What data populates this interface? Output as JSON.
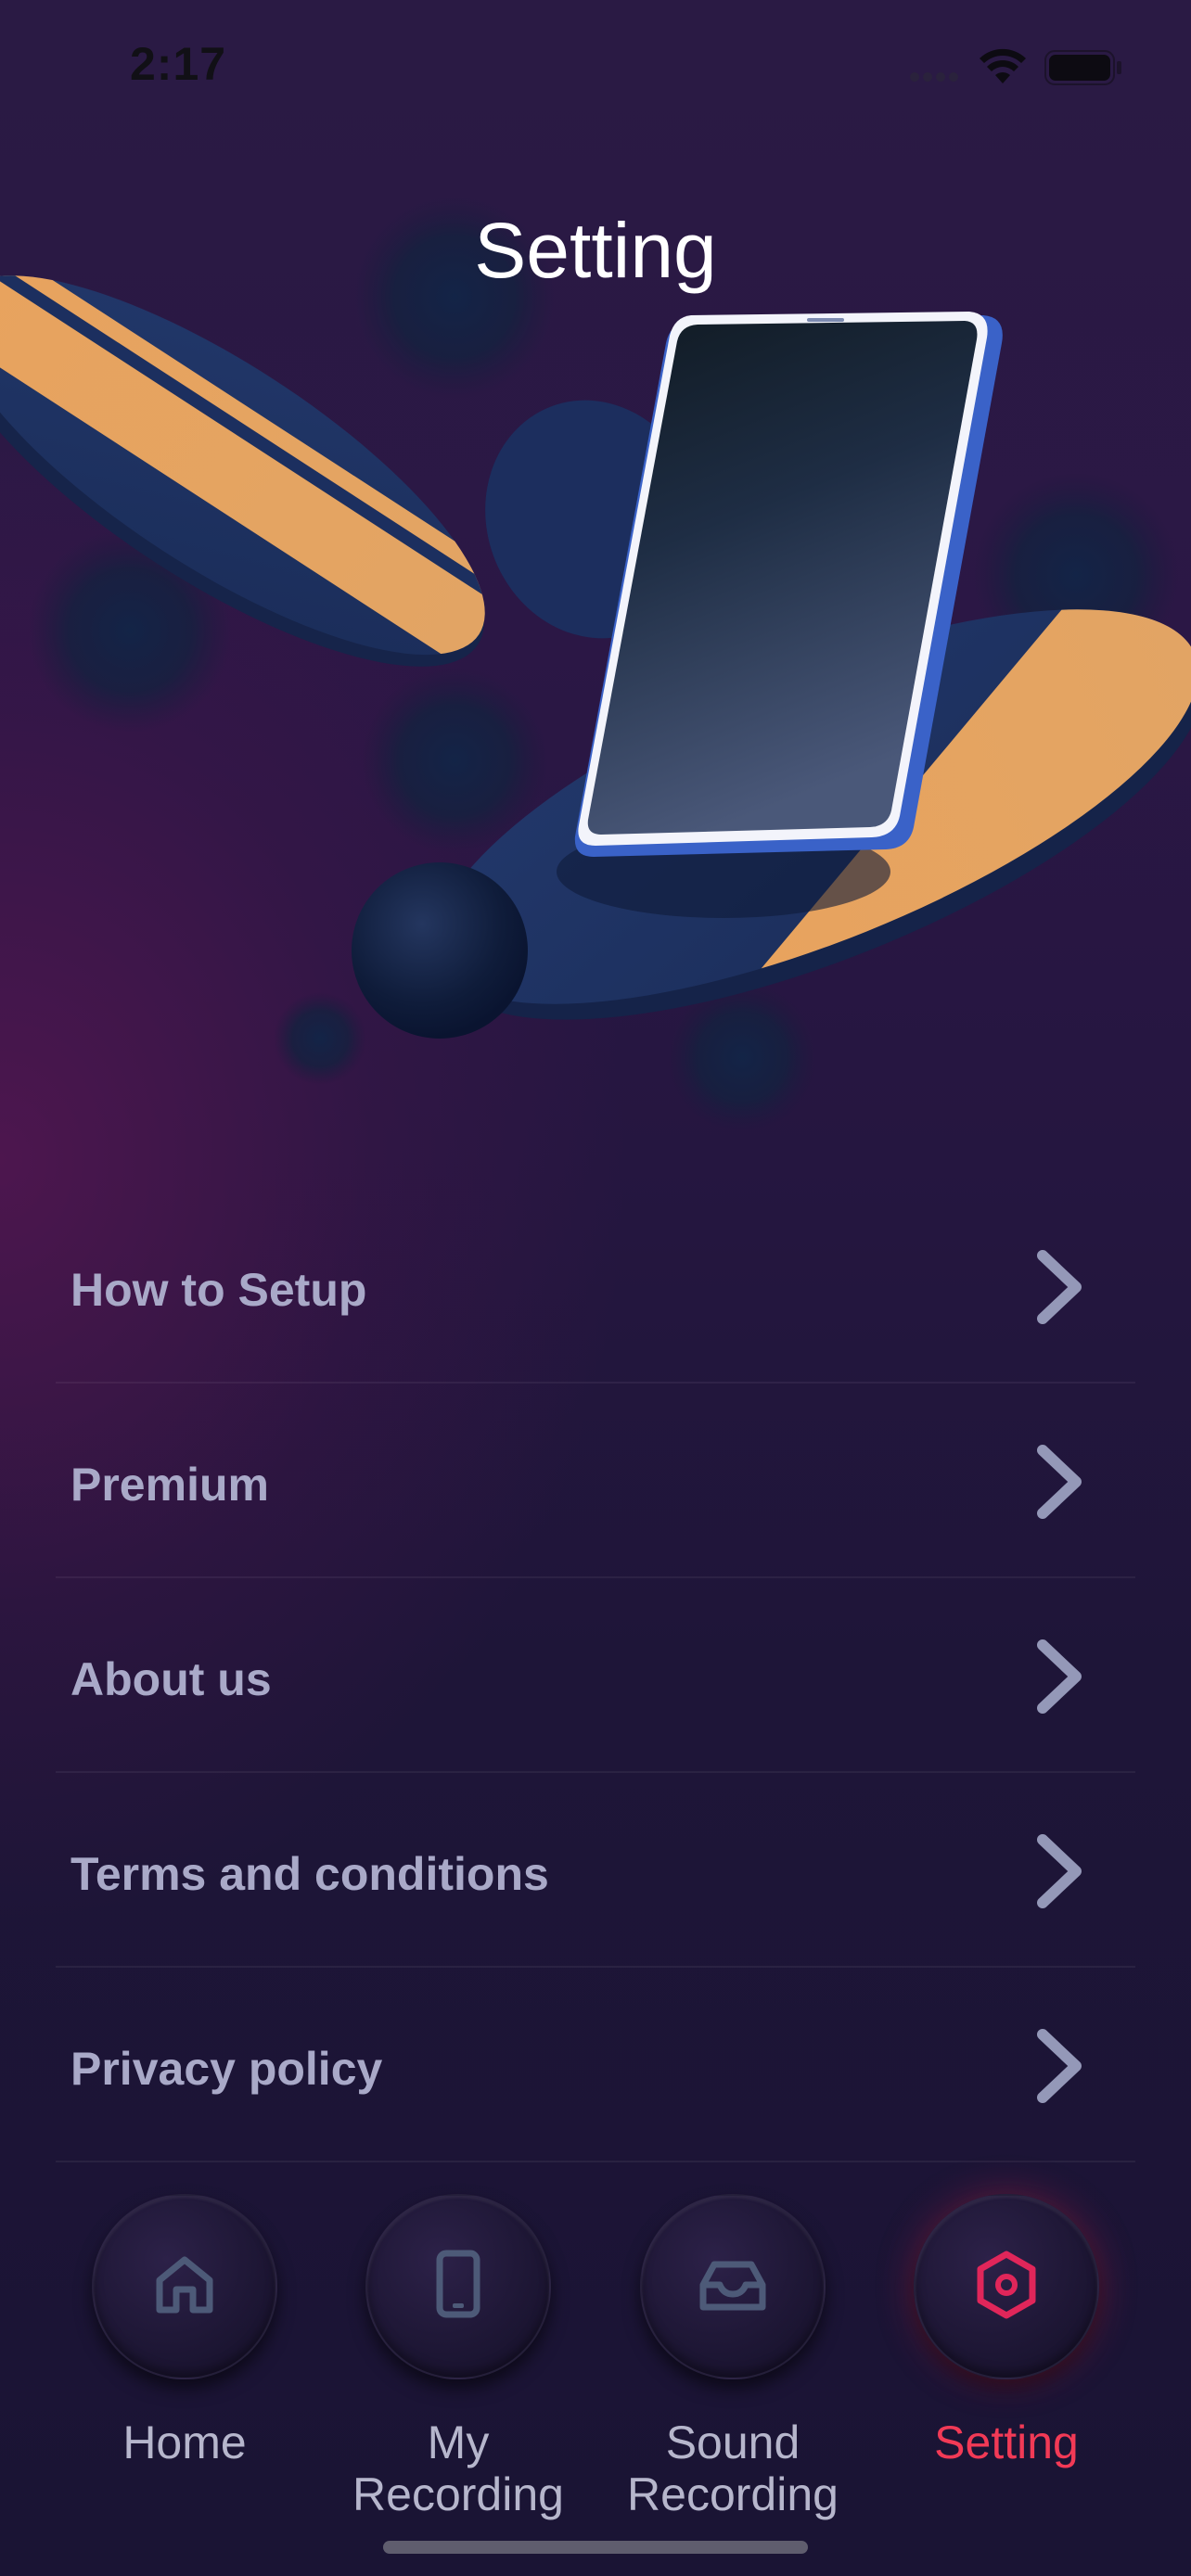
{
  "status_bar": {
    "time": "2:17"
  },
  "header": {
    "title": "Setting"
  },
  "menu": {
    "items": [
      {
        "label": "How to Setup"
      },
      {
        "label": "Premium"
      },
      {
        "label": "About us"
      },
      {
        "label": "Terms and conditions"
      },
      {
        "label": "Privacy policy"
      }
    ]
  },
  "tabbar": {
    "tabs": [
      {
        "line1": "Home",
        "line2": "",
        "icon": "home-icon",
        "active": false
      },
      {
        "line1": "My",
        "line2": "Recording",
        "icon": "phone-icon",
        "active": false
      },
      {
        "line1": "Sound",
        "line2": "Recording",
        "icon": "inbox-icon",
        "active": false
      },
      {
        "line1": "Setting",
        "line2": "",
        "icon": "settings-hexagon-icon",
        "active": true
      }
    ]
  },
  "colors": {
    "accent": "#f23a56",
    "text_muted": "#a9a9c8",
    "background": "#1c1434",
    "illustration_blue": "#1f3466",
    "illustration_orange": "#e39a55"
  }
}
